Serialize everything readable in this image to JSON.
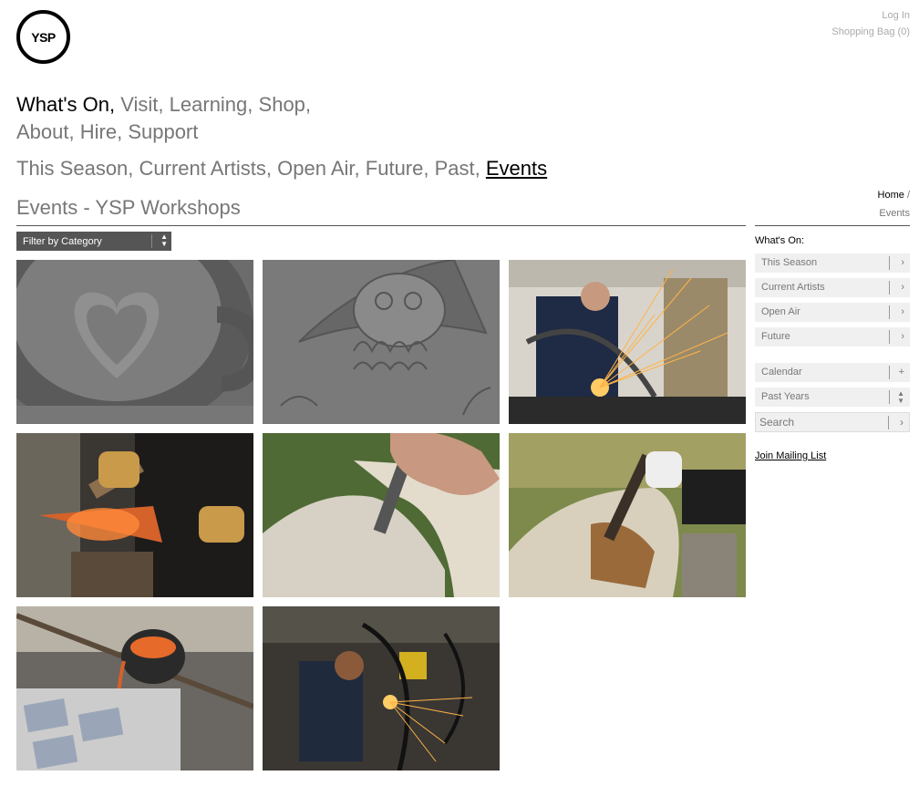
{
  "brand": {
    "logo_text": "YSP"
  },
  "utility": {
    "login": "Log In",
    "bag": "Shopping Bag (0)"
  },
  "main_nav": {
    "items": [
      "What's On,",
      "Visit,",
      "Learning,",
      "Shop,",
      "About,",
      "Hire,",
      "Support"
    ]
  },
  "sub_nav": {
    "items": [
      "This Season,",
      "Current Artists,",
      "Open Air,",
      "Future,",
      "Past,",
      "Events"
    ]
  },
  "page": {
    "title": "Events - YSP Workshops"
  },
  "breadcrumb": {
    "home": "Home",
    "sep": "/",
    "current": "Events"
  },
  "filter": {
    "label": "Filter by Category"
  },
  "tiles": [
    {
      "name": "tile-latte-art",
      "accent": "#6f6f6f"
    },
    {
      "name": "tile-drawing",
      "accent": "#7a7a7a"
    },
    {
      "name": "tile-welding",
      "accent": "#3b3a38"
    },
    {
      "name": "tile-blacksmith",
      "accent": "#2a2420"
    },
    {
      "name": "tile-stone-carving",
      "accent": "#b8b6a8"
    },
    {
      "name": "tile-wood-carving",
      "accent": "#7d8a4c"
    },
    {
      "name": "tile-metal-pouring",
      "accent": "#4a4846"
    },
    {
      "name": "tile-grinding",
      "accent": "#3a3733"
    }
  ],
  "sidebar": {
    "heading": "What's On:",
    "items": [
      "This Season",
      "Current Artists",
      "Open Air",
      "Future"
    ],
    "calendar": "Calendar",
    "past_years": "Past Years",
    "search_placeholder": "Search",
    "mailing": "Join Mailing List"
  }
}
